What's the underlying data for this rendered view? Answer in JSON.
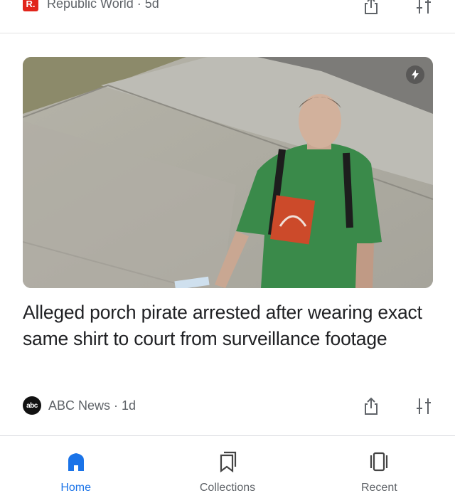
{
  "top_card": {
    "source_logo_letter": "R.",
    "source": "Republic World · 5d"
  },
  "article": {
    "headline": "Alleged porch pirate arrested after wearing exact same shirt to court from surveillance footage",
    "source_logo_text": "abc",
    "source": "ABC News · 1d",
    "image_icon": "flash-icon"
  },
  "bottom_nav": {
    "items": [
      {
        "label": "Home",
        "icon": "home-icon",
        "active": true
      },
      {
        "label": "Collections",
        "icon": "bookmark-icon",
        "active": false
      },
      {
        "label": "Recent",
        "icon": "recent-icon",
        "active": false
      }
    ]
  },
  "colors": {
    "accent": "#1a73e8",
    "republic_red": "#e1251b",
    "text_secondary": "#5f6368"
  }
}
